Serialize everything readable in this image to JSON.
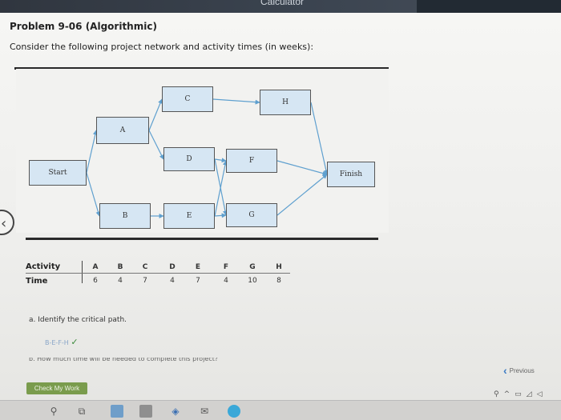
{
  "window": {
    "title": "Calculator"
  },
  "problem": {
    "title": "Problem 9-06 (Algorithmic)",
    "prompt": "Consider the following project network and activity times (in weeks):"
  },
  "network": {
    "nodes": [
      {
        "id": "start",
        "label": "Start"
      },
      {
        "id": "A",
        "label": "A"
      },
      {
        "id": "B",
        "label": "B"
      },
      {
        "id": "C",
        "label": "C"
      },
      {
        "id": "D",
        "label": "D"
      },
      {
        "id": "E",
        "label": "E"
      },
      {
        "id": "F",
        "label": "F"
      },
      {
        "id": "G",
        "label": "G"
      },
      {
        "id": "H",
        "label": "H"
      },
      {
        "id": "finish",
        "label": "Finish"
      }
    ],
    "edges": [
      [
        "start",
        "A"
      ],
      [
        "start",
        "B"
      ],
      [
        "A",
        "C"
      ],
      [
        "A",
        "D"
      ],
      [
        "B",
        "E"
      ],
      [
        "C",
        "H"
      ],
      [
        "D",
        "F"
      ],
      [
        "D",
        "G"
      ],
      [
        "E",
        "F"
      ],
      [
        "E",
        "G"
      ],
      [
        "F",
        "finish"
      ],
      [
        "G",
        "finish"
      ],
      [
        "H",
        "finish"
      ]
    ],
    "node_color": "#d6e6f3",
    "edge_color": "#5fa0cf"
  },
  "activity_table": {
    "row_label_activity": "Activity",
    "row_label_time": "Time",
    "activities": [
      "A",
      "B",
      "C",
      "D",
      "E",
      "F",
      "G",
      "H"
    ],
    "times": [
      "6",
      "4",
      "7",
      "4",
      "7",
      "4",
      "10",
      "8"
    ]
  },
  "questions": {
    "a_label": "a. Identify the critical path.",
    "a_answer": "B-E-F-H",
    "b_label": "b. How much time will be needed to complete this project?"
  },
  "buttons": {
    "check": "Check My Work",
    "previous": "Previous"
  },
  "icons": {
    "check": "check-mark-icon",
    "previous": "chevron-left-icon",
    "side": "chevron-left-icon"
  },
  "colors": {
    "check_button": "#7a9c4d",
    "answer_text": "#8aa6c8",
    "correct_mark": "#3a8a3a",
    "previous_chevron": "#3d7cc4"
  }
}
